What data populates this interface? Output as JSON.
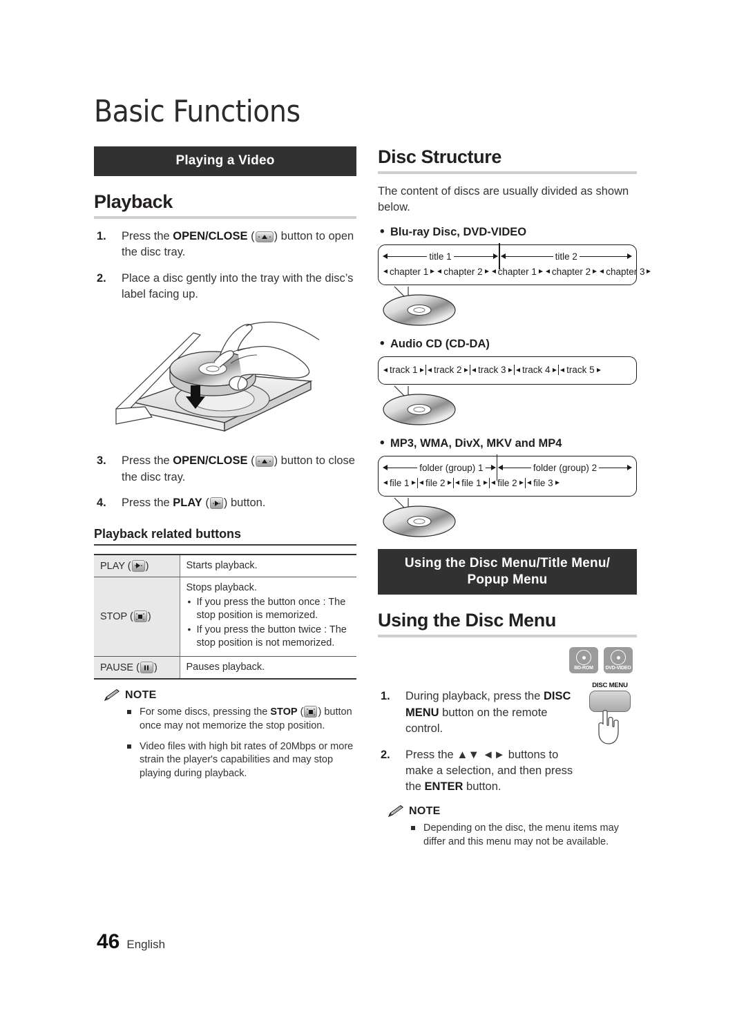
{
  "page": {
    "chapter_title": "Basic Functions",
    "page_number": "46",
    "language": "English"
  },
  "left": {
    "banner": "Playing a Video",
    "playback_heading": "Playback",
    "steps": [
      {
        "num": "1.",
        "pre": "Press the ",
        "bold": "OPEN/CLOSE",
        "mid": " (",
        "icon": "eject-button-icon",
        "post": ") button to open the disc tray."
      },
      {
        "num": "2.",
        "pre": "Place a disc gently into the tray with the disc’s label facing up.",
        "bold": "",
        "mid": "",
        "icon": "",
        "post": ""
      },
      {
        "num": "3.",
        "pre": "Press the ",
        "bold": "OPEN/CLOSE",
        "mid": " (",
        "icon": "eject-button-icon",
        "post": ") button to close the disc tray."
      },
      {
        "num": "4.",
        "pre": "Press the ",
        "bold": "PLAY",
        "mid": " (",
        "icon": "play-button-icon",
        "post": ") button."
      }
    ],
    "illustration_name": "disc-tray-loading-illustration",
    "related_buttons_heading": "Playback related buttons",
    "table": {
      "rows": [
        {
          "key_label": "PLAY",
          "key_icon": "play-button-icon",
          "desc": "Starts playback.",
          "bullets": []
        },
        {
          "key_label": "STOP",
          "key_icon": "stop-button-icon",
          "desc": "Stops playback.",
          "bullets": [
            "If you press the button once : The stop position is memorized.",
            "If you press the button twice : The stop position is not memorized."
          ]
        },
        {
          "key_label": "PAUSE",
          "key_icon": "pause-button-icon",
          "desc": "Pauses playback.",
          "bullets": []
        }
      ]
    },
    "note": {
      "label": "NOTE",
      "icon": "pencil-note-icon",
      "items": [
        {
          "pre": "For some discs, pressing the ",
          "bold": "STOP",
          "mid": " (",
          "icon": "stop-button-icon",
          "post": ") button once may not memorize the stop position."
        },
        {
          "pre": "Video files with high bit rates of 20Mbps or more strain the player's capabilities and may stop playing during playback.",
          "bold": "",
          "mid": "",
          "icon": "",
          "post": ""
        }
      ]
    }
  },
  "right": {
    "disc_structure_heading": "Disc Structure",
    "intro": "The content of discs are usually divided as shown below.",
    "sections": [
      {
        "title": "Blu-ray Disc, DVD-VIDEO",
        "top_labels": [
          "title 1",
          "title 2"
        ],
        "bottom_labels": [
          "chapter 1",
          "chapter 2",
          "chapter 1",
          "chapter 2",
          "chapter 3"
        ]
      },
      {
        "title": "Audio CD (CD-DA)",
        "top_labels": [],
        "bottom_labels": [
          "track 1",
          "track 2",
          "track 3",
          "track 4",
          "track 5"
        ]
      },
      {
        "title": "MP3, WMA, DivX, MKV and MP4",
        "top_labels": [
          "folder (group) 1",
          "folder (group) 2"
        ],
        "bottom_labels": [
          "file 1",
          "file 2",
          "file 1",
          "file 2",
          "file 3"
        ]
      }
    ],
    "banner": "Using the Disc Menu/Title Menu/ Popup Menu",
    "banner_line1": "Using the Disc Menu/Title Menu/",
    "banner_line2": "Popup Menu",
    "using_heading": "Using the Disc Menu",
    "format_icons": [
      {
        "label": "BD-ROM",
        "name": "bd-rom-format-icon"
      },
      {
        "label": "DVD-VIDEO",
        "name": "dvd-video-format-icon"
      }
    ],
    "remote": {
      "label": "DISC MENU",
      "name": "remote-disc-menu-button"
    },
    "steps": [
      {
        "num": "1.",
        "pre": "During playback, press the ",
        "bold": "DISC MENU",
        "post": " button on the remote control."
      },
      {
        "num": "2.",
        "pre": "Press the ▲▼ ◄► buttons to make a selection, and then press the ",
        "bold": "ENTER",
        "post": " button."
      }
    ],
    "note": {
      "label": "NOTE",
      "icon": "pencil-note-icon",
      "items": [
        "Depending on the disc, the menu items may differ and this menu may not be available."
      ]
    }
  }
}
